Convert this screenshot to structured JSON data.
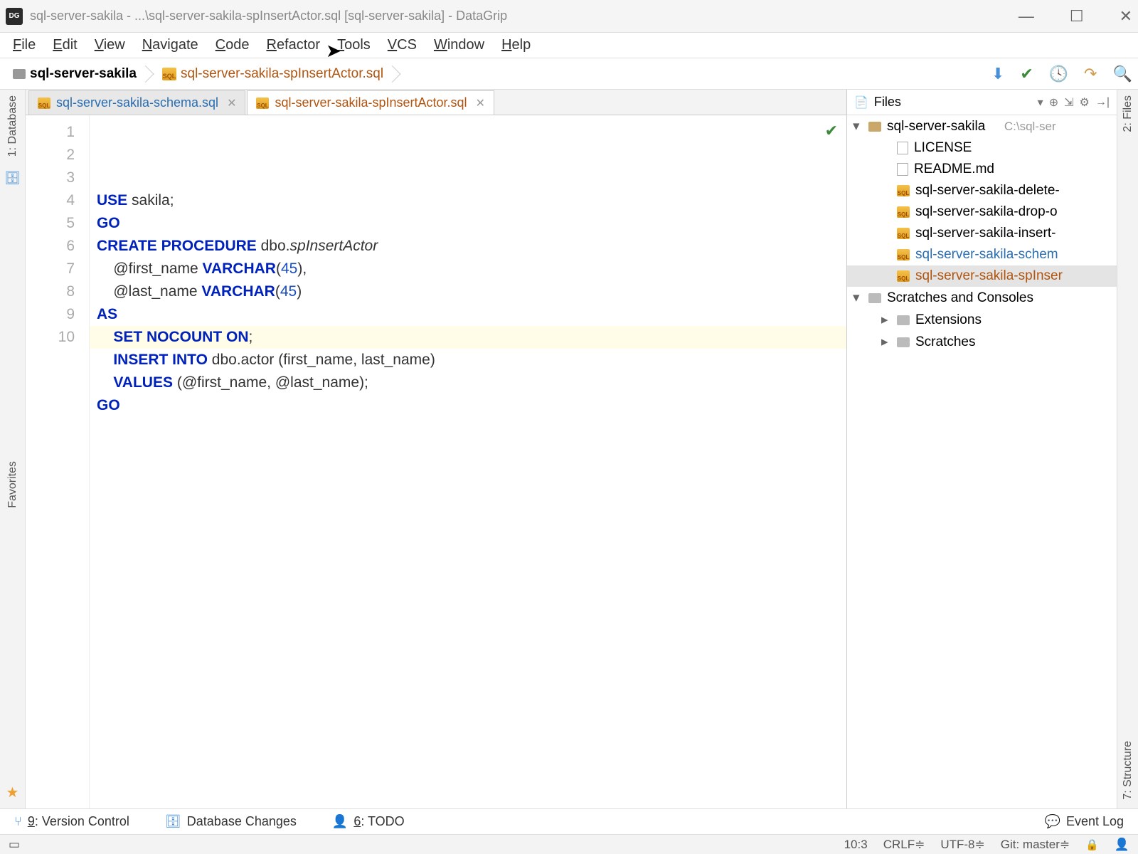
{
  "titlebar": {
    "app_badge": "DG",
    "text": "sql-server-sakila - ...\\sql-server-sakila-spInsertActor.sql [sql-server-sakila] - DataGrip"
  },
  "menu": [
    "File",
    "Edit",
    "View",
    "Navigate",
    "Code",
    "Refactor",
    "Tools",
    "VCS",
    "Window",
    "Help"
  ],
  "breadcrumb": {
    "project": "sql-server-sakila",
    "file": "sql-server-sakila-spInsertActor.sql"
  },
  "tabs": [
    {
      "label": "sql-server-sakila-schema.sql",
      "active": false,
      "color": "blue"
    },
    {
      "label": "sql-server-sakila-spInsertActor.sql",
      "active": true,
      "color": "orange"
    }
  ],
  "editor": {
    "lines": [
      "1",
      "2",
      "3",
      "4",
      "5",
      "6",
      "7",
      "8",
      "9",
      "10"
    ],
    "highlighted_line": 10,
    "code_tokens": [
      [
        [
          "kw",
          "USE"
        ],
        [
          "ident",
          " sakila"
        ],
        [
          "paren",
          ";"
        ]
      ],
      [
        [
          "kw",
          "GO"
        ]
      ],
      [
        [
          "kw",
          "CREATE PROCEDURE"
        ],
        [
          "ident",
          " dbo."
        ],
        [
          "italic ident",
          "spInsertActor"
        ]
      ],
      [
        [
          "ident",
          "    @first_name "
        ],
        [
          "kw",
          "VARCHAR"
        ],
        [
          "paren",
          "("
        ],
        [
          "num",
          "45"
        ],
        [
          "paren",
          "),"
        ]
      ],
      [
        [
          "ident",
          "    @last_name "
        ],
        [
          "kw",
          "VARCHAR"
        ],
        [
          "paren",
          "("
        ],
        [
          "num",
          "45"
        ],
        [
          "paren",
          ")"
        ]
      ],
      [
        [
          "kw",
          "AS"
        ]
      ],
      [
        [
          "ident",
          "    "
        ],
        [
          "kw",
          "SET NOCOUNT ON"
        ],
        [
          "paren",
          ";"
        ]
      ],
      [
        [
          "ident",
          "    "
        ],
        [
          "kw",
          "INSERT INTO"
        ],
        [
          "ident",
          " dbo.actor "
        ],
        [
          "paren",
          "("
        ],
        [
          "ident",
          "first_name"
        ],
        [
          "paren",
          ", "
        ],
        [
          "ident",
          "last_name"
        ],
        [
          "paren",
          ")"
        ]
      ],
      [
        [
          "ident",
          "    "
        ],
        [
          "kw",
          "VALUES"
        ],
        [
          "ident",
          " "
        ],
        [
          "paren",
          "("
        ],
        [
          "ident",
          "@first_name"
        ],
        [
          "paren",
          ", "
        ],
        [
          "ident",
          "@last_name"
        ],
        [
          "paren",
          ");"
        ]
      ],
      [
        [
          "kw",
          "GO"
        ]
      ]
    ]
  },
  "filepanel": {
    "title": "Files",
    "root": {
      "name": "sql-server-sakila",
      "hint": "C:\\sql-ser"
    },
    "files": [
      {
        "type": "file",
        "name": "LICENSE"
      },
      {
        "type": "file",
        "name": "README.md"
      },
      {
        "type": "sql",
        "name": "sql-server-sakila-delete-"
      },
      {
        "type": "sql",
        "name": "sql-server-sakila-drop-o"
      },
      {
        "type": "sql",
        "name": "sql-server-sakila-insert-"
      },
      {
        "type": "sql",
        "name": "sql-server-sakila-schem",
        "color": "blue"
      },
      {
        "type": "sql",
        "name": "sql-server-sakila-spInser",
        "color": "orange",
        "selected": true
      }
    ],
    "scratches": {
      "label": "Scratches and Consoles",
      "children": [
        "Extensions",
        "Scratches"
      ]
    }
  },
  "left_tools": {
    "database": "1: Database",
    "favorites": "Favorites"
  },
  "right_tools": {
    "files": "2: Files",
    "structure": "7: Structure"
  },
  "bottom": {
    "vc": "9: Version Control",
    "dbchanges": "Database Changes",
    "todo": "6: TODO",
    "eventlog": "Event Log"
  },
  "status": {
    "pos": "10:3",
    "crlf": "CRLF",
    "enc": "UTF-8",
    "git": "Git: master"
  }
}
